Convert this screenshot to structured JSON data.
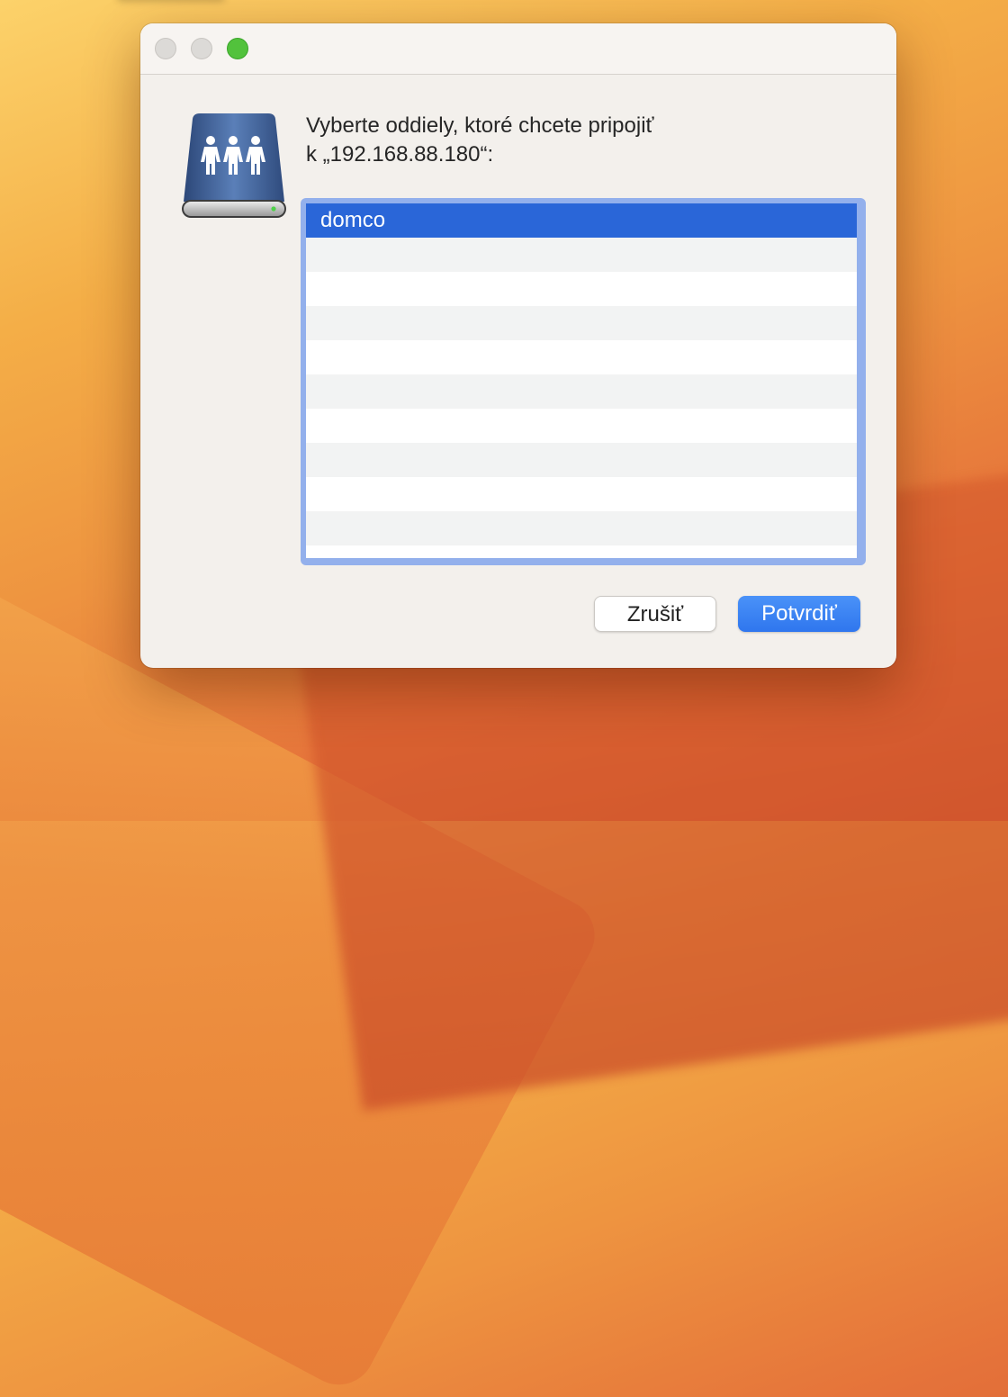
{
  "dialog": {
    "prompt_line1": "Vyberte oddiely, ktoré chcete pripojiť",
    "prompt_line2": "k „192.168.88.180“:",
    "icon": "shared-server-icon",
    "volumes": [
      {
        "name": "domco",
        "selected": true
      }
    ],
    "empty_row_count": 9,
    "cancel_label": "Zrušiť",
    "confirm_label": "Potvrdiť"
  },
  "colors": {
    "selection": "#2a66d8",
    "list_focus_ring": "#93b0ec",
    "confirm_button": "#3b82f6",
    "zoom_button": "#52c23c"
  }
}
